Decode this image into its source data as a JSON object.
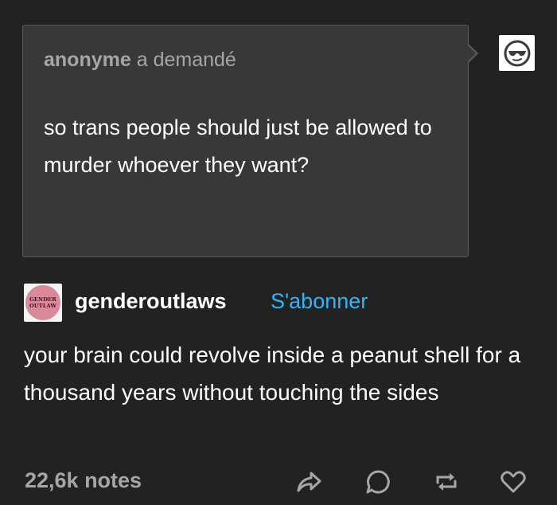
{
  "ask": {
    "asker_name": "anonyme",
    "asked_label": "a demandé",
    "question": "so trans people should just be allowed to murder whoever they want?"
  },
  "anon_avatar": {
    "icon": "sunglasses-face-icon"
  },
  "answer": {
    "blog_name": "genderoutlaws",
    "follow_label": "S'abonner",
    "avatar_text_line1": "GENDER",
    "avatar_text_line2": "OUTLAW",
    "text": "your brain could revolve inside a peanut shell for a thousand years without touching the sides"
  },
  "footer": {
    "notes": "22,6k notes",
    "actions": [
      "share-icon",
      "reply-icon",
      "reblog-icon",
      "like-icon"
    ]
  },
  "colors": {
    "background": "#222222",
    "ask_background": "#383838",
    "follow_link": "#33b5f5",
    "muted_text": "#a6a6a6"
  }
}
